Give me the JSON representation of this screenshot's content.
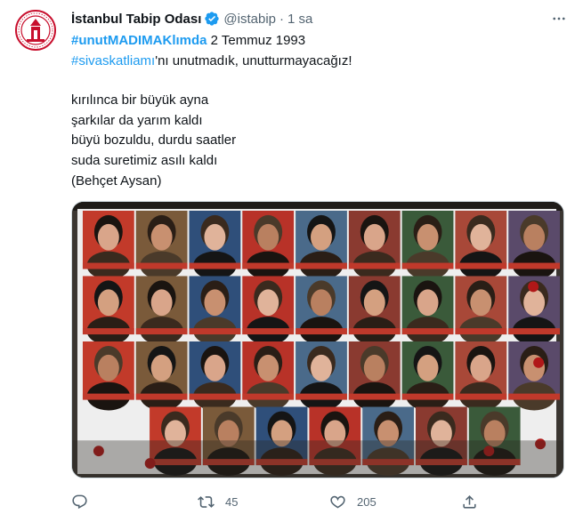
{
  "tweet": {
    "author_name": "İstanbul Tabip Odası",
    "handle": "@istabip",
    "separator": "·",
    "time": "1 sa",
    "hashtag1": "#unutMADIMAKlımda",
    "line1_rest": " 2 Temmuz 1993",
    "hashtag2": "#sivaskatliamı",
    "line2_rest": "'nı unutmadık, unutturmayacağız!",
    "poem": [
      "kırılınca bir büyük ayna",
      "şarkılar da yarım kaldı",
      "büyü bozuldu, durdu saatler",
      "suda suretimiz asılı kaldı",
      " (Behçet Aysan)"
    ]
  },
  "actions": {
    "reply_count": "",
    "retweet_count": "45",
    "like_count": "205",
    "share_count": ""
  },
  "colors": {
    "link": "#1d9bf0",
    "text": "#0f1419",
    "muted": "#536471",
    "verified": "#1d9bf0",
    "logo_red": "#c8102e"
  },
  "icons": {
    "avatar": "istanbul-tabip-odasi-logo",
    "verified": "verified-badge-icon",
    "more": "more-icon",
    "reply": "reply-icon",
    "retweet": "retweet-icon",
    "like": "heart-icon",
    "share": "share-icon"
  }
}
